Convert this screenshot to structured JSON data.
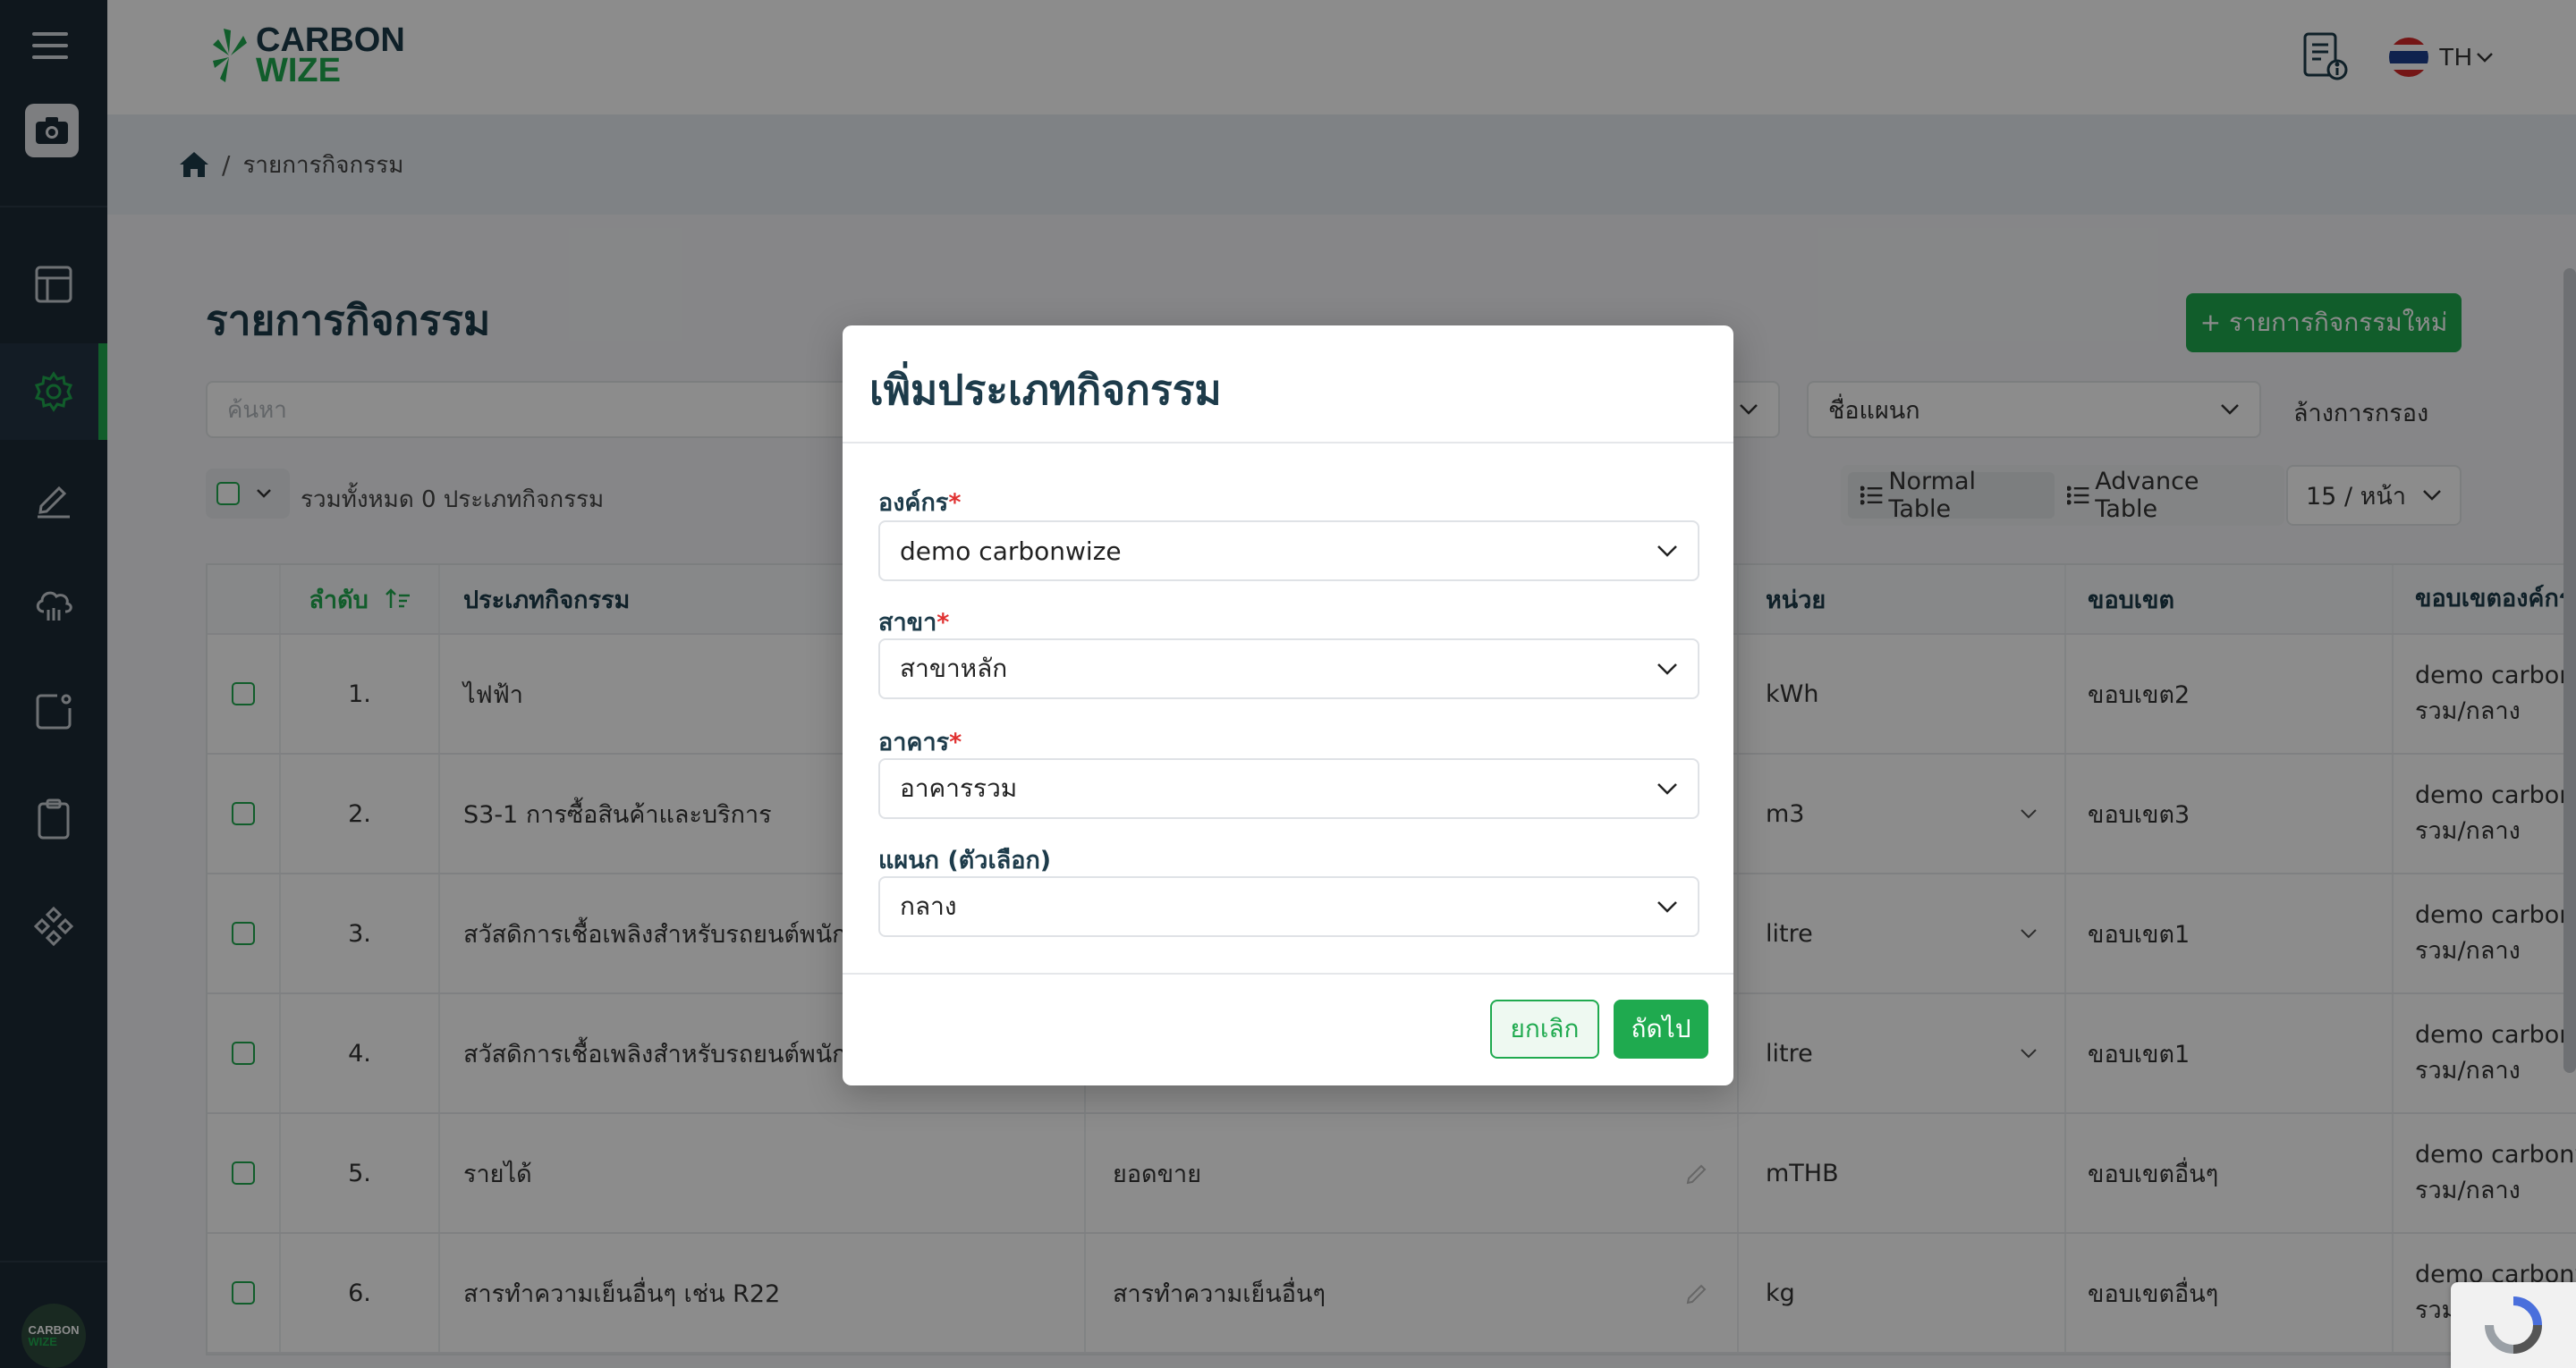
{
  "brand": {
    "line1": "CARBON",
    "line2": "WIZE",
    "mini_line1": "CARBON",
    "mini_line2": "WIZE",
    "accent": "#1faa4f",
    "navy": "#1d3b4a"
  },
  "header": {
    "language": "TH"
  },
  "breadcrumb": {
    "separator": "/",
    "current": "รายการกิจกรรม"
  },
  "page": {
    "title": "รายการกิจกรรม",
    "new_button": "+ รายการกิจกรรมใหม่",
    "search_placeholder": "ค้นหา",
    "filter_dept": "ชื่อแผนก",
    "clear_filter": "ล้างการกรอง",
    "total_text": "รวมทั้งหมด 0 ประเภทกิจกรรม",
    "normal_table": "Normal Table",
    "advance_table": "Advance Table",
    "per_page": "15 / หน้า"
  },
  "table": {
    "headers": {
      "no": "ลำดับ",
      "type": "ประเภทกิจกรรม",
      "unit": "หน่วย",
      "scope": "ขอบเขต",
      "org_scope": "ขอบเขตองค์กร"
    },
    "rows": [
      {
        "no": "1.",
        "type": "ไฟฟ้า",
        "mid": "",
        "unit": "kWh",
        "scope": "ขอบเขต2",
        "org1": "demo carbonwize",
        "org2": "รวม/กลาง"
      },
      {
        "no": "2.",
        "type": "S3-1 การซื้อสินค้าและบริการ",
        "mid": "",
        "unit": "m3",
        "scope": "ขอบเขต3",
        "org1": "demo carbonwize",
        "org2": "รวม/กลาง"
      },
      {
        "no": "3.",
        "type": "สวัสดิการเชื้อเพลิงสำหรับรถยนต์พนักงาน",
        "mid": "",
        "unit": "litre",
        "scope": "ขอบเขต1",
        "org1": "demo carbonwize",
        "org2": "รวม/กลาง"
      },
      {
        "no": "4.",
        "type": "สวัสดิการเชื้อเพลิงสำหรับรถยนต์พนักงาน",
        "mid": "",
        "unit": "litre",
        "scope": "ขอบเขต1",
        "org1": "demo carbonwize",
        "org2": "รวม/กลาง"
      },
      {
        "no": "5.",
        "type": "รายได้",
        "mid": "ยอดขาย",
        "unit": "mTHB",
        "scope": "ขอบเขตอื่นๆ",
        "org1": "demo carbonwize",
        "org2": "รวม/กลาง"
      },
      {
        "no": "6.",
        "type": "สารทำความเย็นอื่นๆ เช่น R22",
        "mid": "สารทำความเย็นอื่นๆ",
        "unit": "kg",
        "scope": "ขอบเขตอื่นๆ",
        "org1": "demo carbonwize",
        "org2": "รวม/กลาง"
      }
    ]
  },
  "modal": {
    "title": "เพิ่มประเภทกิจกรรม",
    "fields": [
      {
        "label": "องค์กร",
        "required": true,
        "value": "demo carbonwize"
      },
      {
        "label": "สาขา",
        "required": true,
        "value": "สาขาหลัก"
      },
      {
        "label": "อาคาร",
        "required": true,
        "value": "อาคารรวม"
      },
      {
        "label": "แผนก (ตัวเลือก)",
        "required": false,
        "value": "กลาง"
      }
    ],
    "cancel": "ยกเลิก",
    "next": "ถัดไป",
    "required_mark": "*"
  }
}
